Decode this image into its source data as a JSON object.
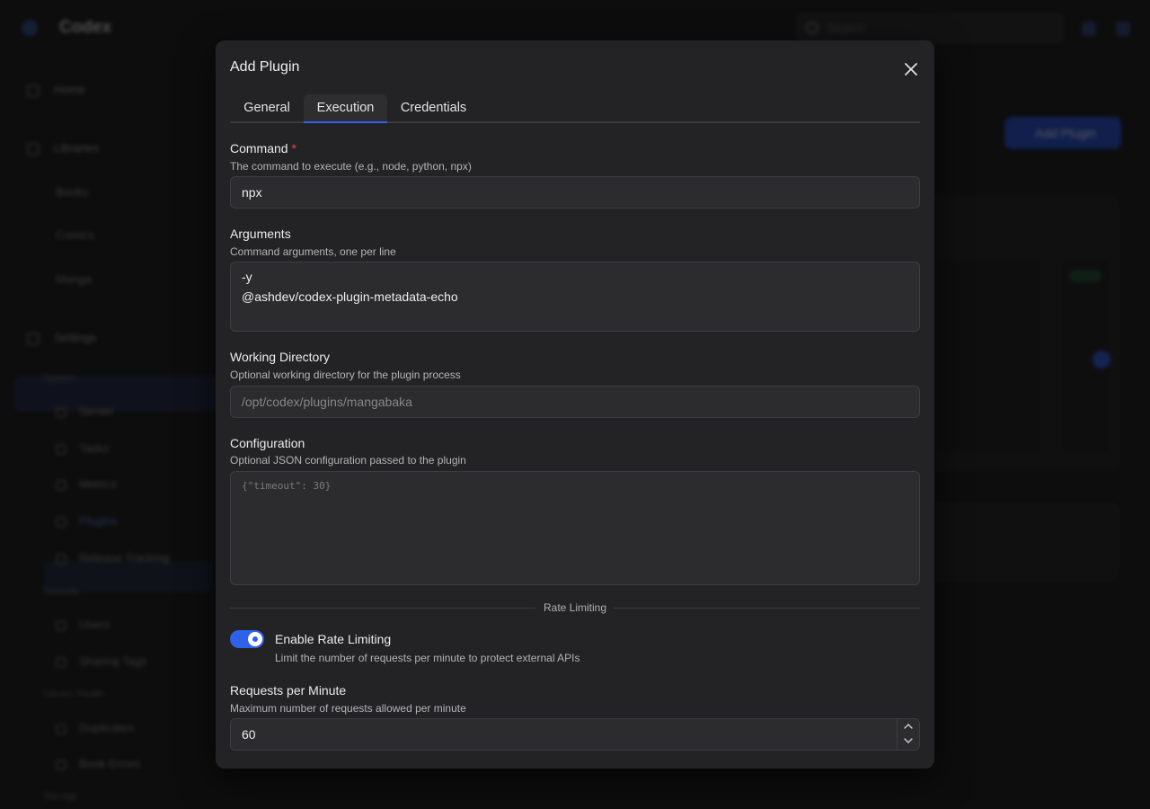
{
  "background": {
    "app_title": "Codex",
    "search_placeholder": "Search",
    "nav": [
      "Home",
      "Libraries",
      "Books",
      "Comics",
      "Manga",
      "Settings"
    ],
    "sections": [
      "System",
      "Security",
      "Library Health",
      "Storage"
    ],
    "settings_items": [
      "Server",
      "Tasks",
      "Metrics",
      "Plugins",
      "Release Tracking",
      "Users",
      "Sharing Tags",
      "Duplicates",
      "Book Errors"
    ],
    "add_button": "Add Plugin"
  },
  "modal": {
    "title": "Add Plugin",
    "tabs": [
      {
        "label": "General",
        "active": false
      },
      {
        "label": "Execution",
        "active": true
      },
      {
        "label": "Credentials",
        "active": false
      }
    ],
    "command": {
      "label": "Command",
      "required_mark": "*",
      "description": "The command to execute (e.g., node, python, npx)",
      "value": "npx"
    },
    "arguments": {
      "label": "Arguments",
      "description": "Command arguments, one per line",
      "lines": [
        "-y",
        "@ashdev/codex-plugin-metadata-echo"
      ]
    },
    "working_directory": {
      "label": "Working Directory",
      "description": "Optional working directory for the plugin process",
      "placeholder": "/opt/codex/plugins/mangabaka"
    },
    "configuration": {
      "label": "Configuration",
      "description": "Optional JSON configuration passed to the plugin",
      "placeholder": "{\"timeout\": 30}"
    },
    "rate_limiting": {
      "divider": "Rate Limiting",
      "toggle_label": "Enable Rate Limiting",
      "toggle_description": "Limit the number of requests per minute to protect external APIs",
      "enabled": true
    },
    "requests_per_minute": {
      "label": "Requests per Minute",
      "description": "Maximum number of requests allowed per minute",
      "value": "60"
    }
  },
  "colors": {
    "accent": "#2f62e8",
    "required": "#e5484d",
    "modal_bg": "#232325"
  }
}
